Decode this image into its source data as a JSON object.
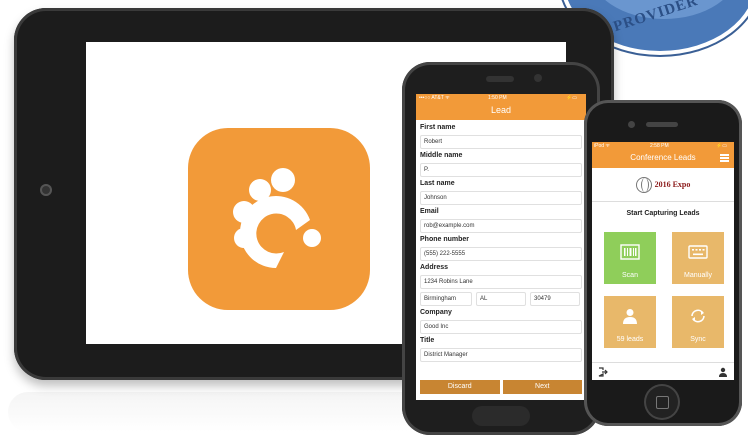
{
  "badge": {
    "text": "PROVIDER"
  },
  "tablet": {
    "app_icon": "app-logo-icon",
    "accent": "#f29a39"
  },
  "android": {
    "status": {
      "carrier": "•••○○ AT&T ᯤ",
      "time": "1:50 PM",
      "battery": "⚡▭"
    },
    "title": "Lead",
    "fields": {
      "first_name_label": "First name",
      "first_name": "Robert",
      "middle_name_label": "Middle name",
      "middle_name": "P.",
      "last_name_label": "Last name",
      "last_name": "Johnson",
      "email_label": "Email",
      "email": "rob@example.com",
      "phone_label": "Phone number",
      "phone": "(555) 222-5555",
      "address_label": "Address",
      "address": "1234 Robins Lane",
      "city": "Birmingham",
      "state": "AL",
      "zip": "30479",
      "company_label": "Company",
      "company": "Good Inc",
      "title_label": "Title",
      "title": "District Manager"
    },
    "buttons": {
      "discard": "Discard",
      "next": "Next"
    }
  },
  "iphone": {
    "status": {
      "left": "iPod ᯤ",
      "time": "2:58 PM",
      "right": "⚡▭"
    },
    "title": "Conference Leads",
    "expo": "2016 Expo",
    "start": "Start Capturing Leads",
    "tiles": {
      "scan": "Scan",
      "manually": "Manually",
      "leads": "59 leads",
      "sync": "Sync"
    },
    "colors": {
      "scan": "#8fce5a",
      "other": "#e8b86a"
    }
  }
}
